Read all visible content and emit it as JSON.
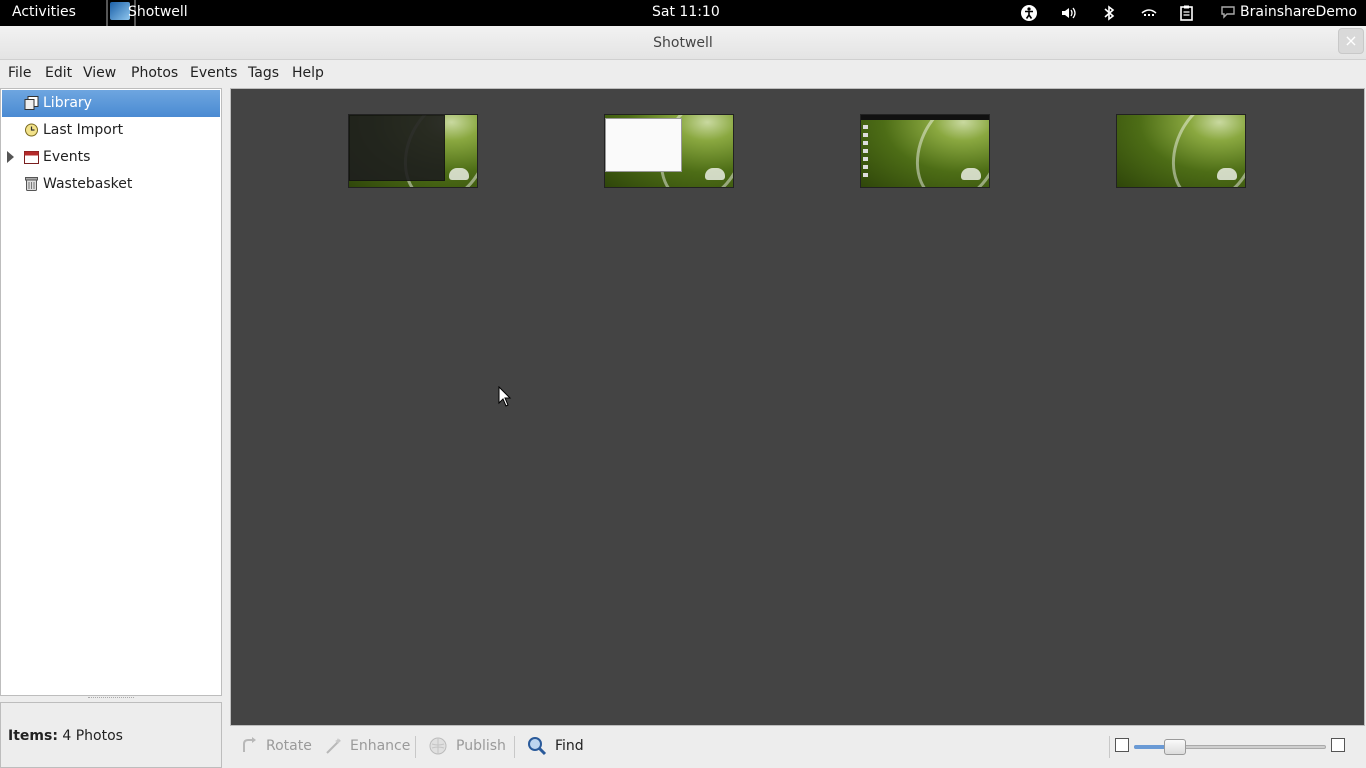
{
  "topbar": {
    "activities": "Activities",
    "app_name": "Shotwell",
    "clock": "Sat 11:10",
    "user": "BrainshareDemo",
    "tray_icons": [
      "accessibility-icon",
      "volume-icon",
      "bluetooth-icon",
      "network-icon",
      "clipboard-icon",
      "chat-icon"
    ]
  },
  "window": {
    "title": "Shotwell",
    "close_glyph": "×"
  },
  "menubar": {
    "items": [
      "File",
      "Edit",
      "View",
      "Photos",
      "Events",
      "Tags",
      "Help"
    ]
  },
  "sidebar": {
    "items": [
      {
        "label": "Library",
        "icon": "library-icon",
        "selected": true
      },
      {
        "label": "Last Import",
        "icon": "clock-icon",
        "selected": false
      },
      {
        "label": "Events",
        "icon": "events-icon",
        "selected": false,
        "expandable": true
      },
      {
        "label": "Wastebasket",
        "icon": "trash-icon",
        "selected": false
      }
    ]
  },
  "status": {
    "label": "Items:",
    "value": "4 Photos"
  },
  "photos": {
    "count": 4,
    "items": [
      "screenshot-thumbnail",
      "screenshot-thumbnail",
      "screenshot-thumbnail",
      "wallpaper-thumbnail"
    ]
  },
  "toolbar": {
    "rotate": "Rotate",
    "enhance": "Enhance",
    "publish": "Publish",
    "find": "Find"
  },
  "colors": {
    "selection": "#4a8ad2",
    "photo_background": "#444444",
    "topbar": "#000000"
  }
}
